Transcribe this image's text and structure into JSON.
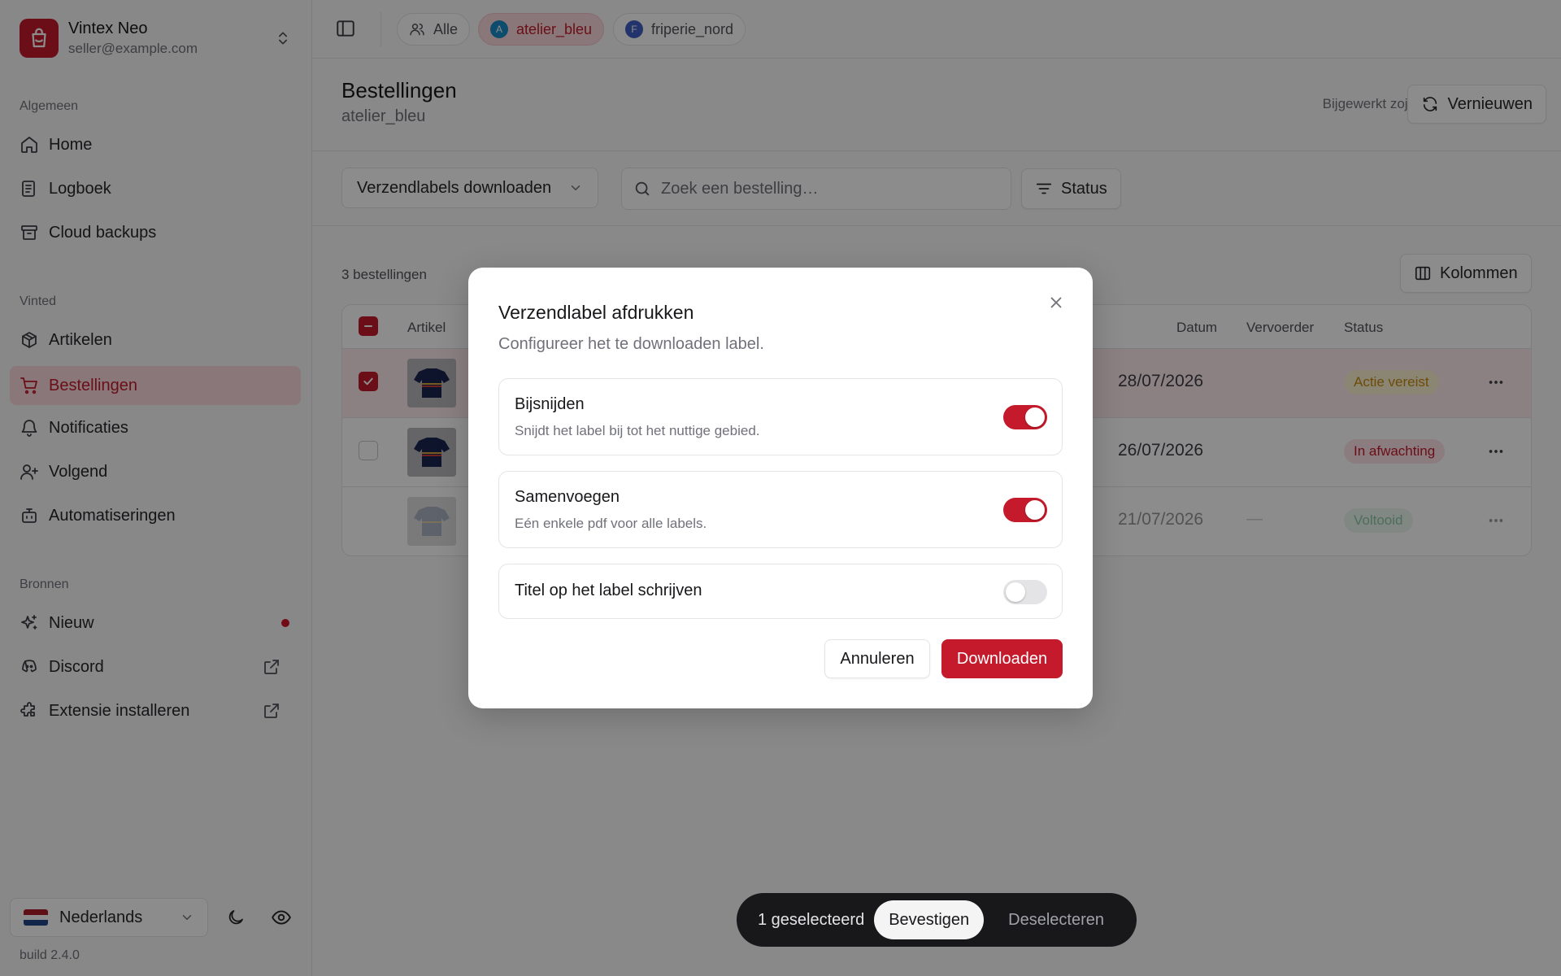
{
  "account": {
    "name": "Vintex Neo",
    "email": "seller@example.com"
  },
  "sidebar": {
    "sections": [
      "Algemeen",
      "Vinted",
      "Bronnen"
    ],
    "general": [
      {
        "label": "Home",
        "icon": "home-icon"
      },
      {
        "label": "Logboek",
        "icon": "logbook-icon"
      },
      {
        "label": "Cloud backups",
        "icon": "archive-icon"
      }
    ],
    "vinted": [
      {
        "label": "Artikelen",
        "icon": "package-icon"
      },
      {
        "label": "Bestellingen",
        "icon": "cart-icon",
        "active": true
      },
      {
        "label": "Notificaties",
        "icon": "bell-icon"
      },
      {
        "label": "Volgend",
        "icon": "user-plus-icon"
      },
      {
        "label": "Automatiseringen",
        "icon": "bot-icon"
      }
    ],
    "sources": [
      {
        "label": "Nieuw",
        "icon": "sparkles-icon"
      },
      {
        "label": "Discord",
        "icon": "discord-icon"
      },
      {
        "label": "Extensie installeren",
        "icon": "puzzle-icon"
      }
    ],
    "language": "Nederlands",
    "build": "build 2.4.0"
  },
  "topbar": {
    "chips": [
      {
        "label": "Alle"
      },
      {
        "label": "atelier_bleu",
        "avatar": "A",
        "active": true
      },
      {
        "label": "friperie_nord",
        "avatar": "F"
      }
    ]
  },
  "page": {
    "title": "Bestellingen",
    "subtitle": "atelier_bleu",
    "updated": "Bijgewerkt zojuist",
    "refresh_label": "Vernieuwen"
  },
  "toolbar": {
    "bulk_action": "Verzendlabels downloaden",
    "search_placeholder": "Zoek een bestelling…",
    "status_filter": "Status",
    "columns_label": "Kolommen"
  },
  "table": {
    "count_label": "3 bestellingen",
    "headers": {
      "item": "Artikel",
      "date": "Datum",
      "carrier": "Vervoerder",
      "status": "Status"
    },
    "rows": [
      {
        "date": "28/07/2026",
        "carrier": "",
        "status": "Actie vereist",
        "selected": true
      },
      {
        "date": "26/07/2026",
        "carrier": "",
        "status": "In afwachting",
        "selected": false
      },
      {
        "date": "21/07/2026",
        "carrier": "—",
        "status": "Voltooid",
        "selected": false
      }
    ]
  },
  "selection_bar": {
    "count": "1 geselecteerd",
    "confirm": "Bevestigen",
    "deselect": "Deselecteren"
  },
  "modal": {
    "title": "Verzendlabel afdrukken",
    "description": "Configureer het te downloaden label.",
    "options": [
      {
        "title": "Bijsnijden",
        "description": "Snijdt het label bij tot het nuttige gebied.",
        "enabled": true
      },
      {
        "title": "Samenvoegen",
        "description": "Eén enkele pdf voor alle labels.",
        "enabled": true
      },
      {
        "title": "Titel op het label schrijven",
        "enabled": false
      }
    ],
    "cancel": "Annuleren",
    "confirm": "Downloaden"
  },
  "colors": {
    "accent": "#c41a2b",
    "status_action": "#e8a317",
    "status_pending": "#c41a2b",
    "status_done": "#2e9e5b"
  }
}
